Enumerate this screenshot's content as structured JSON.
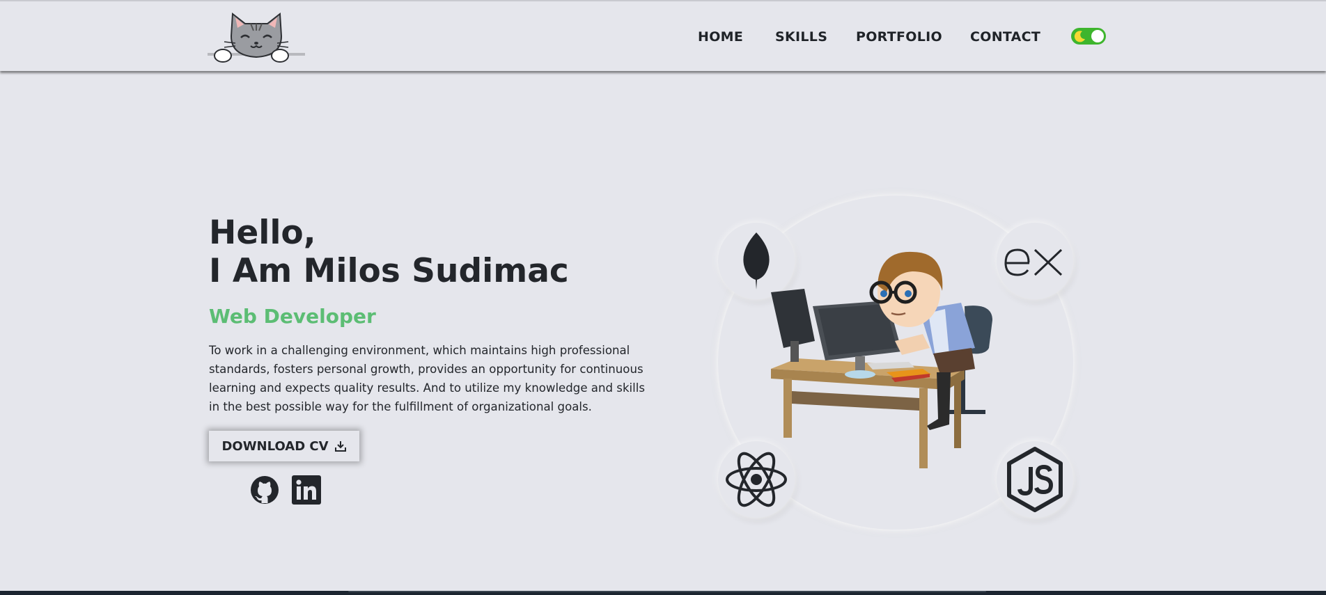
{
  "nav": {
    "items": [
      {
        "label": "HOME"
      },
      {
        "label": "SKILLS"
      },
      {
        "label": "PORTFOLIO"
      },
      {
        "label": "CONTACT"
      }
    ],
    "theme_toggle": {
      "state": "dark-mode-toggle on",
      "accent": "#3eb52d"
    }
  },
  "hero": {
    "greeting": "Hello,",
    "name_line": "I Am Milos Sudimac",
    "role": "Web Developer",
    "role_color": "#5cbd74",
    "description": "To work in a challenging environment, which maintains high professional standards, fosters personal growth, provides an opportunity for continuous learning and expects quality results. And to utilize my knowledge and skills in the best possible way for the fulfillment of organizational goals.",
    "cta_label": "DOWNLOAD CV",
    "cta_icon": "download-icon"
  },
  "social": [
    {
      "icon": "github-icon"
    },
    {
      "icon": "linkedin-icon"
    }
  ],
  "tech_icons": [
    "mongodb-icon",
    "express-icon",
    "react-icon",
    "nodejs-icon"
  ],
  "colors": {
    "background": "#e5e6ec",
    "text": "#23262b",
    "accent_green": "#5cbd74"
  }
}
